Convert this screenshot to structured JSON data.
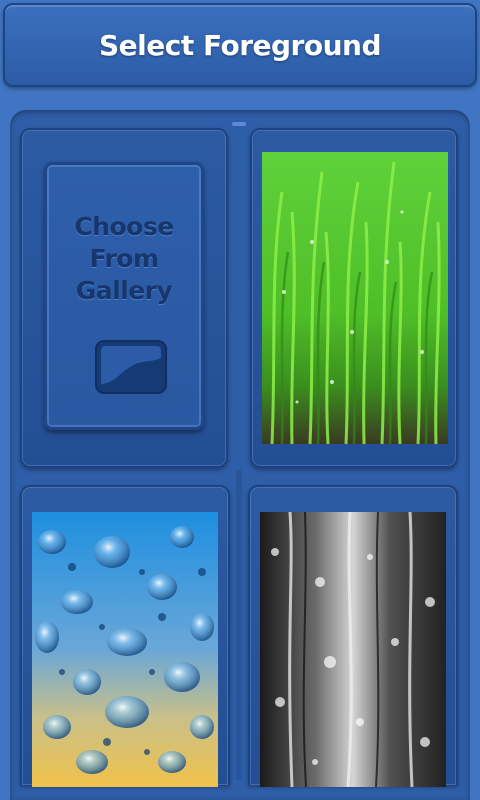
{
  "header": {
    "title": "Select Foreground"
  },
  "gallery": {
    "label_line1": "Choose",
    "label_line2": "From",
    "label_line3": "Gallery",
    "icon": "image-icon"
  },
  "options": [
    {
      "name": "grass",
      "preview": "green-grass-with-dew"
    },
    {
      "name": "water-drops",
      "preview": "water-droplets-blue-yellow"
    },
    {
      "name": "rain-glass",
      "preview": "rain-on-window-grey"
    }
  ],
  "colors": {
    "background": "#3f75c2",
    "panel": "#2f5ea8",
    "title_text": "#ffffff",
    "gallery_text": "#17366b"
  }
}
